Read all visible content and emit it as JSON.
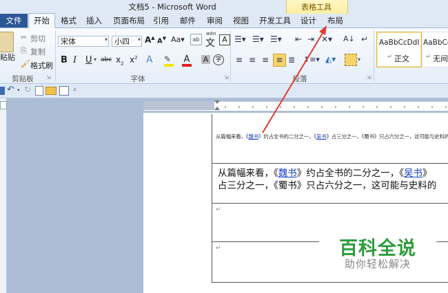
{
  "window": {
    "title": "文档5 - Microsoft Word",
    "context_group": "表格工具"
  },
  "tabs": {
    "file": "文件",
    "home": "开始",
    "format": "格式",
    "insert": "插入",
    "page_layout": "页面布局",
    "references": "引用",
    "mailings": "邮件",
    "review": "审阅",
    "view": "视图",
    "developer": "开发工具",
    "design": "设计",
    "layout": "布局"
  },
  "clipboard": {
    "paste": "粘贴",
    "cut": "剪切",
    "copy": "复制",
    "format_painter": "格式刷",
    "label": "剪贴板"
  },
  "font": {
    "name": "宋体",
    "size": "小四",
    "label": "字体",
    "phonetic": "wén",
    "phonetic_char": "文"
  },
  "paragraph": {
    "label": "段落"
  },
  "styles": {
    "sample1": "AaBbCcDdI",
    "name1": "正文",
    "sample2": "AaBbCc",
    "name2": "无间"
  },
  "doc": {
    "small": {
      "p1": "从篇幅来看，《",
      "link1": "魏书",
      "p2": "》约占全书的二分之一，《",
      "link2": "吴书",
      "p3": "》占三分之一，《蜀书》只占六分之一，这可能与史料的"
    },
    "big": {
      "line1_a": "从篇幅来看，《",
      "line1_link1": "魏书",
      "line1_b": "》约占全书的二分之一，《",
      "line1_link2": "吴书",
      "line1_c": "》",
      "line2": "占三分之一，《蜀书》只占六分之一，这可能与史料的"
    },
    "mark": "↵"
  },
  "watermark": {
    "title": "百科全说",
    "subtitle": "助你轻松解决"
  },
  "colors": {
    "accent": "#2b5797",
    "link": "#1a3fc8",
    "watermark": "#2e9b3c",
    "arrow": "#e03a30"
  }
}
